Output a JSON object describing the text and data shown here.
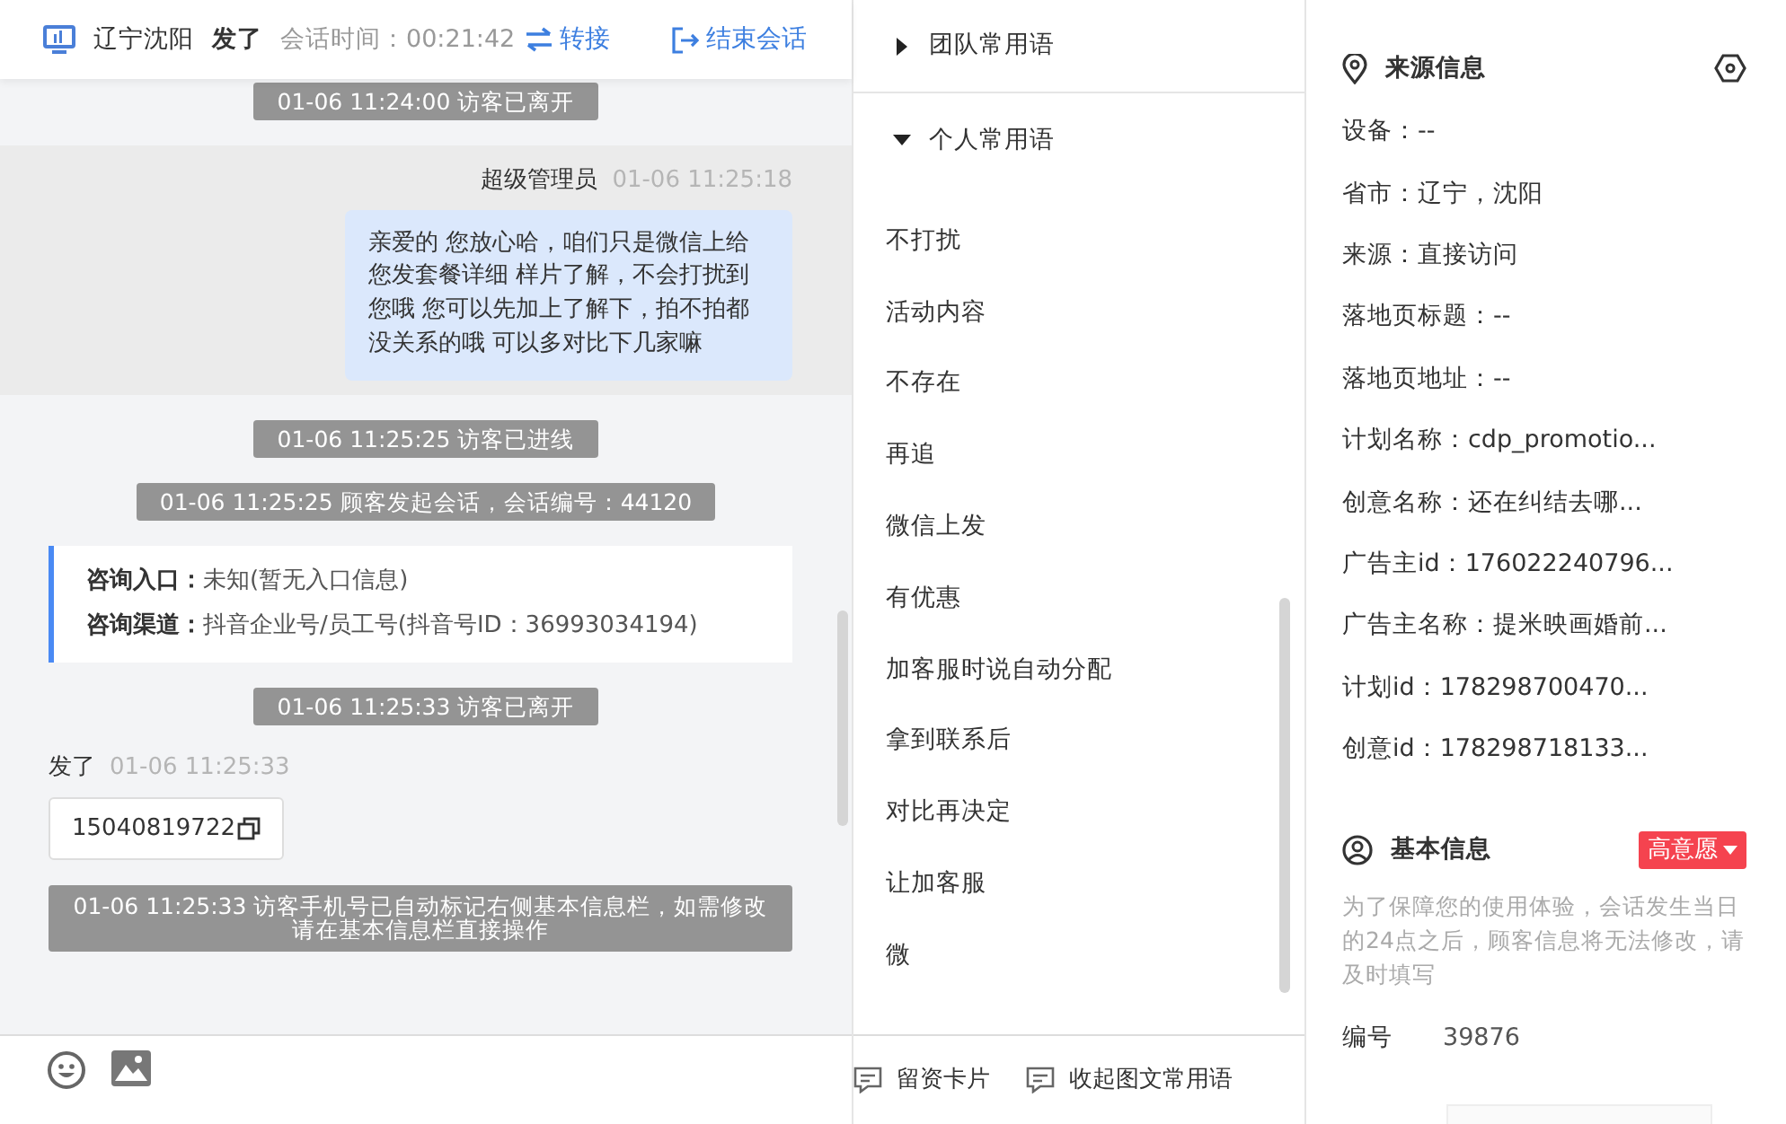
{
  "header": {
    "location": "辽宁沈阳",
    "visitor": "发了",
    "session_time": "会话时间：00:21:42",
    "transfer": "转接",
    "end_session": "结束会话"
  },
  "messages": [
    {
      "kind": "system",
      "text": "01-06 11:24:00 访客已离开"
    },
    {
      "kind": "agent",
      "sender": "超级管理员",
      "time": "01-06 11:25:18",
      "text": "亲爱的 您放心哈，咱们只是微信上给您发套餐详细 样片了解，不会打扰到您哦 您可以先加上了解下，拍不拍都没关系的哦 可以多对比下几家嘛"
    },
    {
      "kind": "system",
      "text": "01-06 11:25:25 访客已进线"
    },
    {
      "kind": "system",
      "text": "01-06 11:25:25 顾客发起会话，会话编号：44120"
    },
    {
      "kind": "info",
      "rows": [
        {
          "label": "咨询入口：",
          "value": "未知(暂无入口信息)"
        },
        {
          "label": "咨询渠道：",
          "value": "抖音企业号/员工号(抖音号ID：36993034194)"
        }
      ]
    },
    {
      "kind": "system",
      "text": "01-06 11:25:33 访客已离开"
    },
    {
      "kind": "visitor",
      "sender": "发了",
      "time": "01-06 11:25:33",
      "text": "15040819722"
    },
    {
      "kind": "system",
      "text": "01-06 11:25:33 访客手机号已自动标记右侧基本信息栏，如需修改请在基本信息栏直接操作"
    }
  ],
  "phrases": {
    "groups": [
      {
        "title": "团队常用语",
        "expanded": false
      },
      {
        "title": "个人常用语",
        "expanded": true,
        "items": [
          "不打扰",
          "活动内容",
          "不存在",
          "再追",
          "微信上发",
          "有优惠",
          "加客服时说自动分配",
          "拿到联系后",
          "对比再决定",
          "让加客服",
          "微"
        ]
      }
    ],
    "footer_buttons": [
      "留资卡片",
      "收起图文常用语"
    ]
  },
  "source_info": {
    "title": "来源信息",
    "fields": [
      "设备：--",
      "省市：辽宁，沈阳",
      "来源：直接访问",
      "落地页标题：--",
      "落地页地址：--",
      "计划名称：cdp_promotio...",
      "创意名称：还在纠结去哪...",
      "广告主id：176022240796...",
      "广告主名称：提米映画婚前...",
      "计划id：178298700470...",
      "创意id：178298718133..."
    ]
  },
  "basic_info": {
    "title": "基本信息",
    "intent_tag": "高意愿",
    "notice": "为了保障您的使用体验，会话发生当日的24点之后，顾客信息将无法修改，请及时填写",
    "fields": [
      {
        "label": "编号",
        "value": "39876"
      }
    ]
  }
}
